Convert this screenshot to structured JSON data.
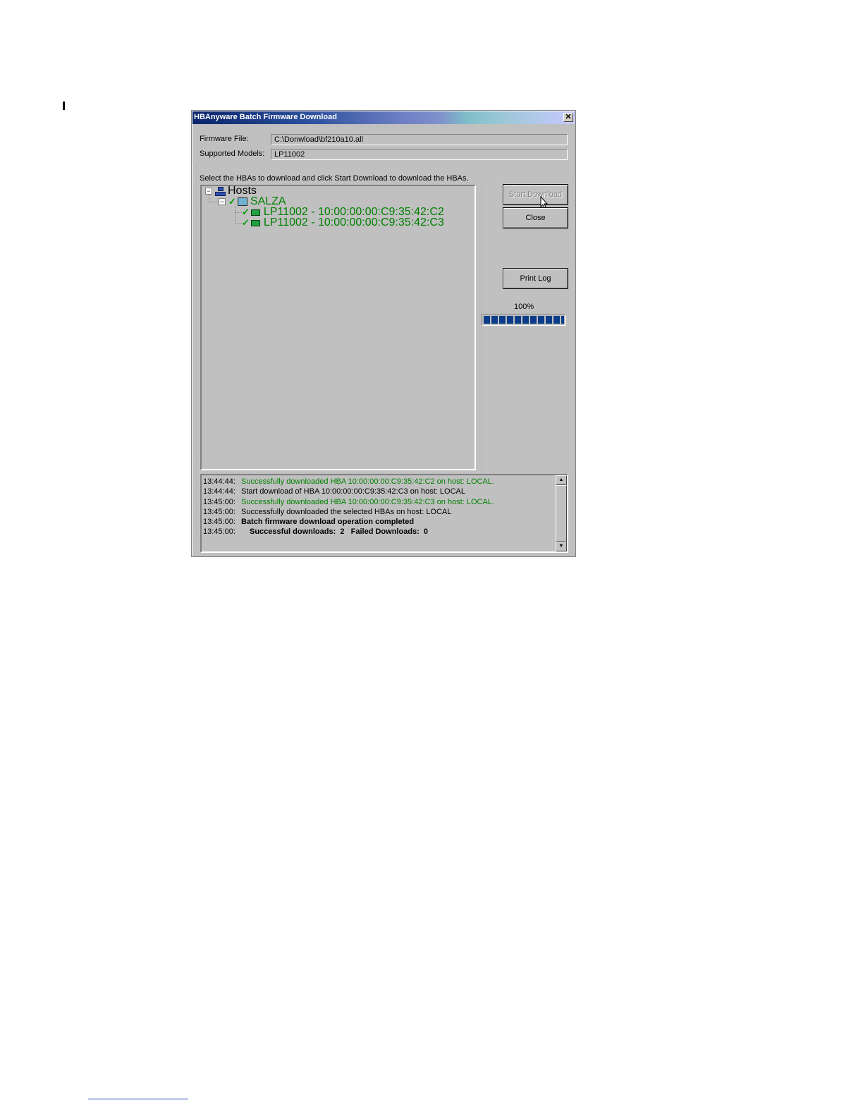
{
  "window": {
    "title": "HBAnyware Batch Firmware Download",
    "close_glyph": "✕"
  },
  "form": {
    "firmware_label": "Firmware File:",
    "firmware_value": "C:\\Donwload\\bf210a10.all",
    "models_label": "Supported Models:",
    "models_value": "LP11002",
    "instruction": "Select the HBAs to download and click Start Download to download the HBAs."
  },
  "tree": {
    "root_label": "Hosts",
    "host_label": "SALZA",
    "hba_1": "LP11002 - 10:00:00:00:C9:35:42:C2",
    "hba_2": "LP11002 - 10:00:00:00:C9:35:42:C3",
    "collapse_glyph": "−",
    "check_glyph": "✓"
  },
  "buttons": {
    "start_download": "Start Download",
    "close": "Close",
    "print_log": "Print Log"
  },
  "progress": {
    "label": "100%",
    "value": 100
  },
  "log": [
    {
      "time": "13:44:44:",
      "msg": "Successfully downloaded HBA 10:00:00:00:C9:35:42:C2 on host: LOCAL."
    },
    {
      "time": "13:44:44:",
      "msg": "Start download of HBA 10:00:00:00:C9:35:42:C3 on host: LOCAL"
    },
    {
      "time": "13:45:00:",
      "msg": "Successfully downloaded HBA 10:00:00:00:C9:35:42:C3 on host: LOCAL."
    },
    {
      "time": "13:45:00:",
      "msg": "Successfully downloaded the selected HBAs on host: LOCAL"
    },
    {
      "time": "13:45:00:",
      "msg": "Batch firmware download operation completed"
    },
    {
      "time": "13:45:00:",
      "msg": "Successful downloads:  2   Failed Downloads:  0"
    }
  ],
  "scrollbar": {
    "up_glyph": "▲",
    "down_glyph": "▼"
  },
  "colors": {
    "success_text": "#008000",
    "progress_fill": "#0a3c8a",
    "title_gradient_start": "#0a246a"
  }
}
